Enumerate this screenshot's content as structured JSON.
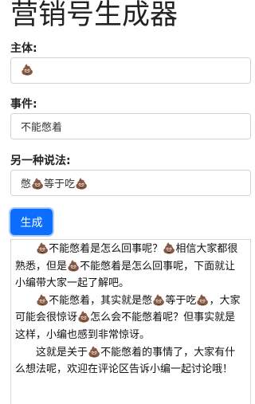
{
  "page": {
    "title": "营销号生成器"
  },
  "form": {
    "subject_label": "主体:",
    "subject_value": "💩",
    "event_label": "事件:",
    "event_value": "不能憋着",
    "alt_label": "另一种说法:",
    "alt_value": "憋💩等于吃💩"
  },
  "actions": {
    "generate_label": "生成"
  },
  "output": {
    "paragraphs": [
      "💩不能憋着是怎么回事呢？💩相信大家都很熟悉，但是💩不能憋着是怎么回事呢，下面就让小编带大家一起了解吧。",
      "💩不能憋着，其实就是憋💩等于吃💩，大家可能会很惊讶💩怎么会不能憋着呢？但事实就是这样，小编也感到非常惊讶。",
      "这就是关于💩不能憋着的事情了，大家有什么想法呢，欢迎在评论区告诉小编一起讨论哦！"
    ]
  }
}
